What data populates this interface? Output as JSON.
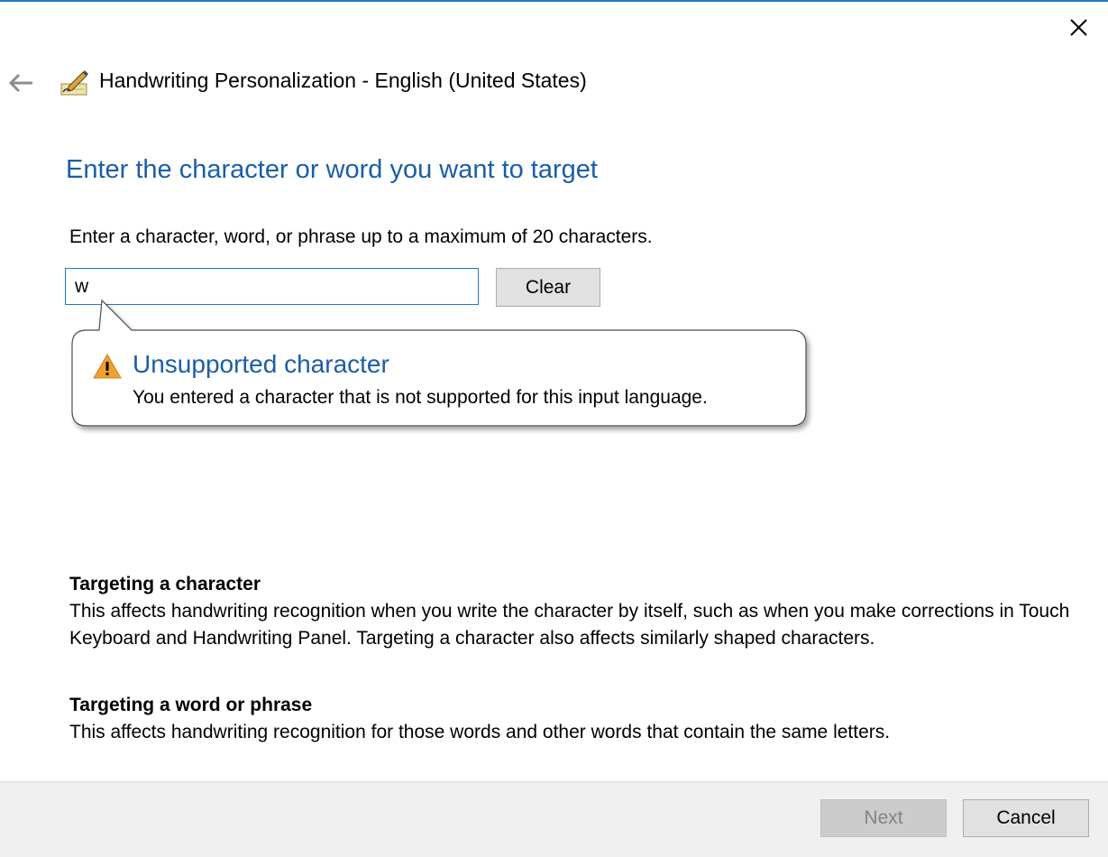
{
  "window": {
    "title": "Handwriting Personalization - English (United States)",
    "accent_color": "#1e7ac8",
    "heading_color": "#1a5ea8",
    "close_icon": "close-icon",
    "back_icon": "back-arrow-icon",
    "app_icon": "handwriting-pen-icon"
  },
  "main": {
    "heading": "Enter the character or word you want to target",
    "instruction": "Enter a character, word, or phrase up to a maximum of 20 characters.",
    "input_value": "w",
    "clear_label": "Clear"
  },
  "balloon": {
    "icon": "warning-icon",
    "warning_color": "#f0a030",
    "title": "Unsupported character",
    "message": "You entered a character that is not supported for this input language."
  },
  "help": [
    {
      "heading": "Targeting a character",
      "body": "This affects handwriting recognition when you write the character by itself, such as when you make corrections in Touch Keyboard and Handwriting Panel. Targeting a character also affects similarly shaped characters."
    },
    {
      "heading": "Targeting a word or phrase",
      "body": "This affects handwriting recognition for those words and other words that contain the same letters."
    }
  ],
  "footer": {
    "next_label": "Next",
    "next_enabled": false,
    "cancel_label": "Cancel"
  }
}
